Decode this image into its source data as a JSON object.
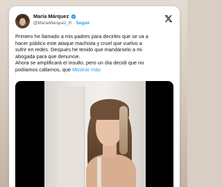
{
  "tweet": {
    "author_name": "María Márquez",
    "handle": "@MariaMarquez_R",
    "separator": "·",
    "follow_label": "Seguir",
    "text_lines": [
      "Primero he llamado a mis padres para decirles que se va a",
      "hacer público este ataque machista y cruel que vuelvo a",
      "sufrir en redes. Después he tenido que mandárselo a mi",
      "abogada para que denuncie.",
      "Ahora se amplificará el insulto, pero un día decidí que no",
      "podíamos callarnos, que"
    ],
    "show_more_label": "Mostrar más"
  },
  "icons": {
    "verified": "verified-badge-icon",
    "platform_logo": "x-logo-icon"
  },
  "colors": {
    "accent": "#1d9bf0",
    "text": "#0f1419",
    "muted": "#536471",
    "background": "#d8cec3"
  }
}
